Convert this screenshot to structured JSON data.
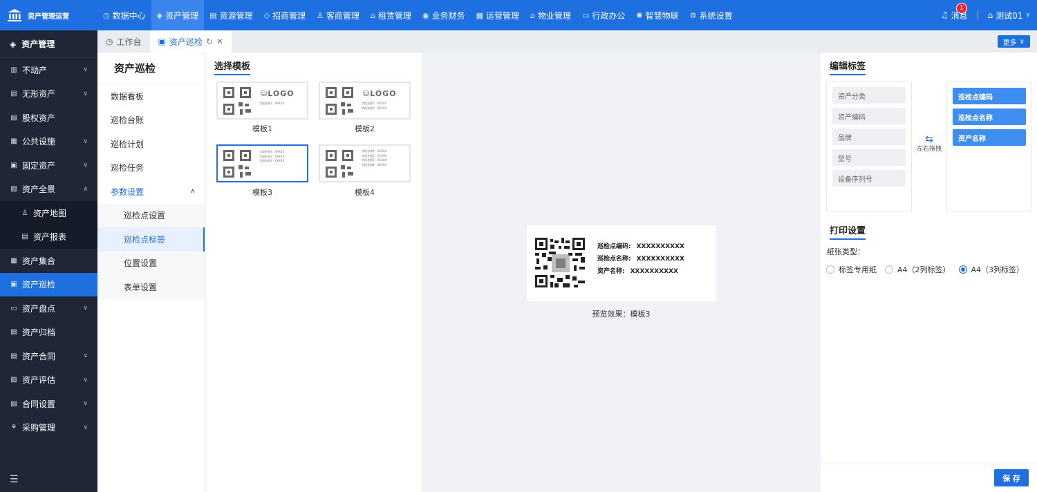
{
  "app": {
    "title": "资产管理运营"
  },
  "topnav": [
    {
      "label": "数据中心",
      "icon": "clock-icon",
      "active": false
    },
    {
      "label": "资产管理",
      "icon": "cube-icon",
      "active": true
    },
    {
      "label": "资源管理",
      "icon": "chart-icon",
      "active": false
    },
    {
      "label": "招商管理",
      "icon": "tag-icon",
      "active": false
    },
    {
      "label": "客商管理",
      "icon": "users-icon",
      "active": false
    },
    {
      "label": "租赁管理",
      "icon": "home-icon",
      "active": false
    },
    {
      "label": "业务财务",
      "icon": "coin-icon",
      "active": false
    },
    {
      "label": "运营管理",
      "icon": "grid-icon",
      "active": false
    },
    {
      "label": "物业管理",
      "icon": "house-icon",
      "active": false
    },
    {
      "label": "行政办公",
      "icon": "monitor-icon",
      "active": false
    },
    {
      "label": "智慧物联",
      "icon": "atom-icon",
      "active": false
    },
    {
      "label": "系统设置",
      "icon": "gear-icon",
      "active": false
    }
  ],
  "topright": {
    "message_label": "消息",
    "message_count": "1",
    "user_label": "测试01"
  },
  "sidebar": {
    "header": "资产管理",
    "items": [
      {
        "label": "不动产",
        "chev": true
      },
      {
        "label": "无形资产",
        "chev": true
      },
      {
        "label": "股权资产",
        "chev": false
      },
      {
        "label": "公共设施",
        "chev": true
      },
      {
        "label": "固定资产",
        "chev": true
      },
      {
        "label": "资产全景",
        "chev": true
      },
      {
        "label": "资产地图",
        "chev": false
      },
      {
        "label": "资产报表",
        "chev": false
      },
      {
        "label": "资产集合",
        "chev": false
      },
      {
        "label": "资产巡检",
        "chev": false
      },
      {
        "label": "资产盘点",
        "chev": true
      },
      {
        "label": "资产归档",
        "chev": false
      },
      {
        "label": "资产合同",
        "chev": true
      },
      {
        "label": "资产评估",
        "chev": true
      },
      {
        "label": "合同设置",
        "chev": true
      },
      {
        "label": "采购管理",
        "chev": true
      }
    ]
  },
  "tabs": [
    {
      "label": "工作台",
      "active": false
    },
    {
      "label": "资产巡检",
      "active": true
    }
  ],
  "tabs_more": "更多",
  "subnav": {
    "title": "资产巡检",
    "items": [
      "数据看板",
      "巡检台账",
      "巡检计划",
      "巡检任务",
      "参数设置"
    ],
    "subitems": [
      "巡检点设置",
      "巡检点标签",
      "位置设置",
      "表单设置"
    ]
  },
  "templates": {
    "title": "选择模板",
    "logo_text": "LOGO",
    "items": [
      {
        "label": "模板1",
        "lines": [
          "字段名称1：XXXXX"
        ]
      },
      {
        "label": "模板2",
        "lines": [
          "字段名称1：XXXXX",
          "字段名称2：XXXXX"
        ]
      },
      {
        "label": "模板3",
        "lines": [
          "字段名称1：XXXXX",
          "字段名称2：XXXXX",
          "字段名称3：XXXXX"
        ]
      },
      {
        "label": "模板4",
        "lines": [
          "字段名称1：XXXXX",
          "字段名称2：XXXXX",
          "字段名称3：XXXXX",
          "字段名称4：XXXXX"
        ]
      }
    ],
    "selected": "模板3"
  },
  "preview": {
    "fields": [
      {
        "key": "巡检点编码:",
        "value": "XXXXXXXXXX"
      },
      {
        "key": "巡检点名称:",
        "value": "XXXXXXXXXX"
      },
      {
        "key": "资产名称:",
        "value": "XXXXXXXXXX"
      }
    ],
    "caption": "预览效果：模板3"
  },
  "edit": {
    "title": "编辑标签",
    "available": [
      "资产分类",
      "资产编码",
      "品牌",
      "型号",
      "设备序列号"
    ],
    "selected": [
      "巡检点编码",
      "巡检点名称",
      "资产名称"
    ],
    "swap_label": "左右拖拽"
  },
  "print": {
    "title": "打印设置",
    "paper_label": "纸张类型：",
    "options": [
      "标签专用纸",
      "A4（2列标签）",
      "A4（3列标签）"
    ],
    "selected_index": 2
  },
  "save_label": "保 存",
  "colors": {
    "primary": "#1e6fe0",
    "sidebar": "#1f2636",
    "chip_blue": "#3d8ef0"
  }
}
